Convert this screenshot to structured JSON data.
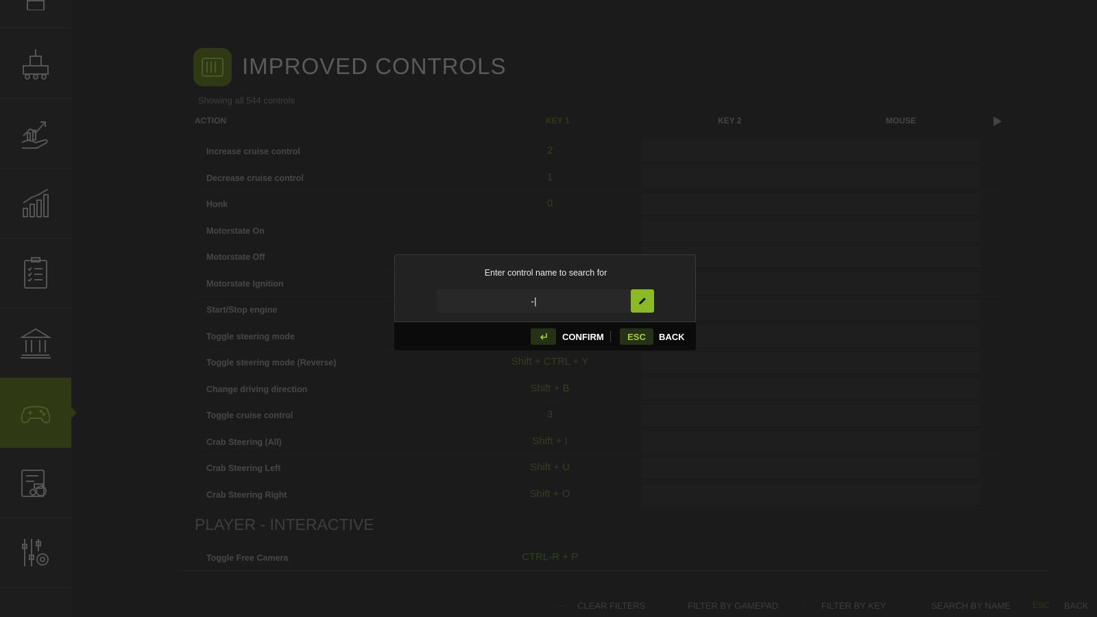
{
  "header": {
    "title": "IMPROVED CONTROLS",
    "count_text": "Showing all 544 controls"
  },
  "columns": {
    "action": "ACTION",
    "key1": "KEY 1",
    "key2": "KEY 2",
    "mouse": "MOUSE"
  },
  "rows": [
    {
      "action": "Increase cruise control",
      "key1": "2"
    },
    {
      "action": "Decrease cruise control",
      "key1": "1"
    },
    {
      "action": "Honk",
      "key1": "0"
    },
    {
      "action": "Motorstate On",
      "key1": ""
    },
    {
      "action": "Motorstate Off",
      "key1": ""
    },
    {
      "action": "Motorstate Ignition",
      "key1": ""
    },
    {
      "action": "Start/Stop engine",
      "key1": ""
    },
    {
      "action": "Toggle steering mode",
      "key1": ""
    },
    {
      "action": "Toggle steering mode (Reverse)",
      "key1": "Shift + CTRL + Y"
    },
    {
      "action": "Change driving direction",
      "key1": "Shift + B"
    },
    {
      "action": "Toggle cruise control",
      "key1": "3"
    },
    {
      "action": "Crab Steering (All)",
      "key1": "Shift + I"
    },
    {
      "action": "Crab Steering Left",
      "key1": "Shift + U"
    },
    {
      "action": "Crab Steering Right",
      "key1": "Shift + O"
    }
  ],
  "section": {
    "title": "PLAYER - INTERACTIVE",
    "row": {
      "action": "Toggle Free Camera",
      "key1": "CTRL-R + P"
    }
  },
  "dialog": {
    "prompt": "Enter control name to search for",
    "input_value": "-|",
    "confirm_label": "CONFIRM",
    "esc_key": "ESC",
    "back_label": "BACK"
  },
  "footer": {
    "clear_filters": "CLEAR FILTERS",
    "filter_gamepad": "FILTER BY GAMEPAD",
    "filter_key": "FILTER BY KEY",
    "search_name": "SEARCH BY NAME",
    "esc_key": "ESC",
    "back": "BACK"
  },
  "sidebar": {
    "icons": [
      "map-icon",
      "factory-icon",
      "finance-icon",
      "statistics-icon",
      "checklist-icon",
      "bank-icon",
      "gamepad-icon",
      "vehicle-list-icon",
      "settings-icon"
    ],
    "active_index": 6
  },
  "colors": {
    "accent": "#8cba24",
    "active_bg": "#2f3a14",
    "background": "#1b1b1b"
  }
}
